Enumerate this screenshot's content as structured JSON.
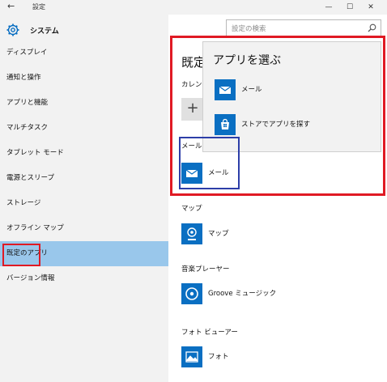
{
  "titlebar": {
    "back": "←",
    "title": "設定",
    "minimize": "—",
    "maximize": "☐",
    "close": "✕"
  },
  "sidebar": {
    "header": "システム",
    "items": [
      {
        "label": "ディスプレイ"
      },
      {
        "label": "通知と操作"
      },
      {
        "label": "アプリと機能"
      },
      {
        "label": "マルチタスク"
      },
      {
        "label": "タブレット モード"
      },
      {
        "label": "電源とスリープ"
      },
      {
        "label": "ストレージ"
      },
      {
        "label": "オフライン マップ"
      },
      {
        "label": "既定のアプリ"
      },
      {
        "label": "バージョン情報"
      }
    ]
  },
  "search": {
    "placeholder": "設定の検索"
  },
  "main": {
    "title": "既定",
    "calendar_label": "カレンダ",
    "plus": "+",
    "mail_label": "メール",
    "mail_app": "メール",
    "maps_label": "マップ",
    "maps_app": "マップ",
    "music_label": "音楽プレーヤー",
    "music_app": "Groove ミュージック",
    "photo_label": "フォト ビューアー",
    "photo_app": "フォト"
  },
  "popup": {
    "title": "アプリを選ぶ",
    "items": [
      {
        "label": "メール",
        "icon": "mail-icon"
      },
      {
        "label": "ストアでアプリを探す",
        "icon": "store-icon"
      }
    ]
  },
  "colors": {
    "accent": "#0a6fc2",
    "selected": "#99c7eb",
    "highlight_red": "#e01a24",
    "highlight_blue": "#2d3ea8"
  }
}
